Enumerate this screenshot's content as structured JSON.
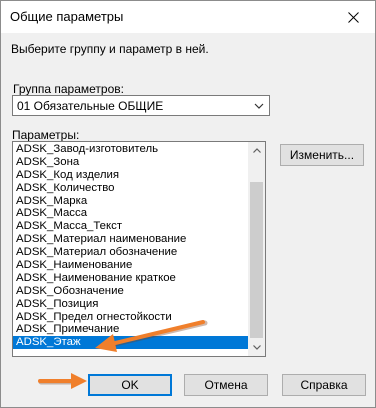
{
  "window": {
    "title": "Общие параметры",
    "close_icon": "close-icon"
  },
  "hint": "Выберите группу и параметр в ней.",
  "group": {
    "label": "Группа параметров:",
    "selected": "01 Обязательные ОБЩИЕ"
  },
  "params": {
    "label": "Параметры:",
    "items": [
      "ADSK_Завод-изготовитель",
      "ADSK_Зона",
      "ADSK_Код изделия",
      "ADSK_Количество",
      "ADSK_Марка",
      "ADSK_Масса",
      "ADSK_Масса_Текст",
      "ADSK_Материал наименование",
      "ADSK_Материал обозначение",
      "ADSK_Наименование",
      "ADSK_Наименование краткое",
      "ADSK_Обозначение",
      "ADSK_Позиция",
      "ADSK_Предел огнестойкости",
      "ADSK_Примечание",
      "ADSK_Этаж"
    ],
    "selected_item": "ADSK_Этаж"
  },
  "buttons": {
    "change": "Изменить...",
    "ok": "OK",
    "cancel": "Отмена",
    "help": "Справка"
  },
  "colors": {
    "selection": "#0078d7",
    "annotation_arrow": "#f07f2b"
  }
}
